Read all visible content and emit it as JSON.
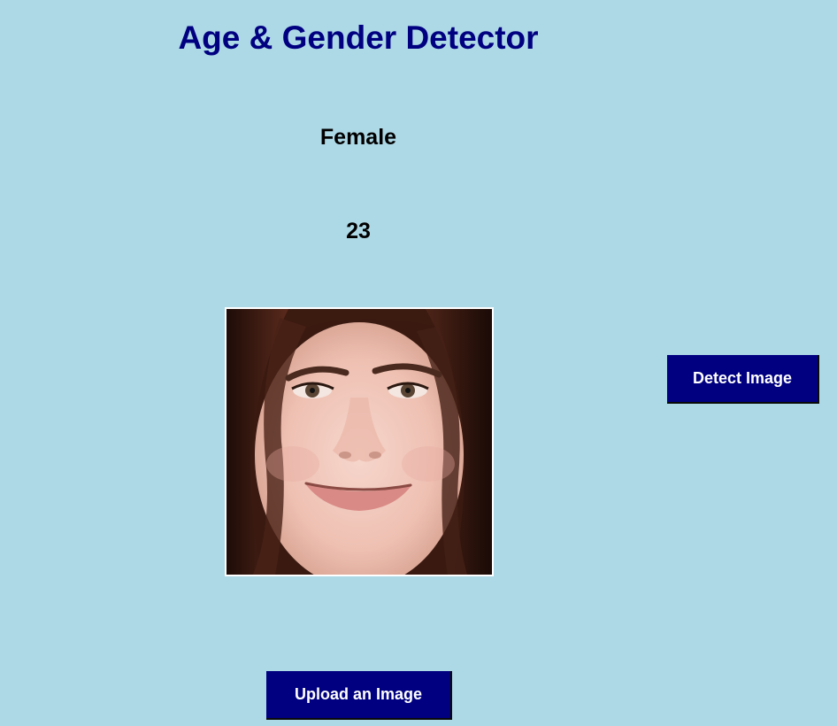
{
  "app": {
    "title": "Age & Gender Detector"
  },
  "result": {
    "gender": "Female",
    "age": "23"
  },
  "buttons": {
    "detect_label": "Detect Image",
    "upload_label": "Upload an Image"
  },
  "colors": {
    "background": "#add8e6",
    "title": "#000080",
    "button_bg": "#000080",
    "button_text": "#ffffff"
  },
  "image": {
    "semantic": "uploaded-face-photo"
  }
}
